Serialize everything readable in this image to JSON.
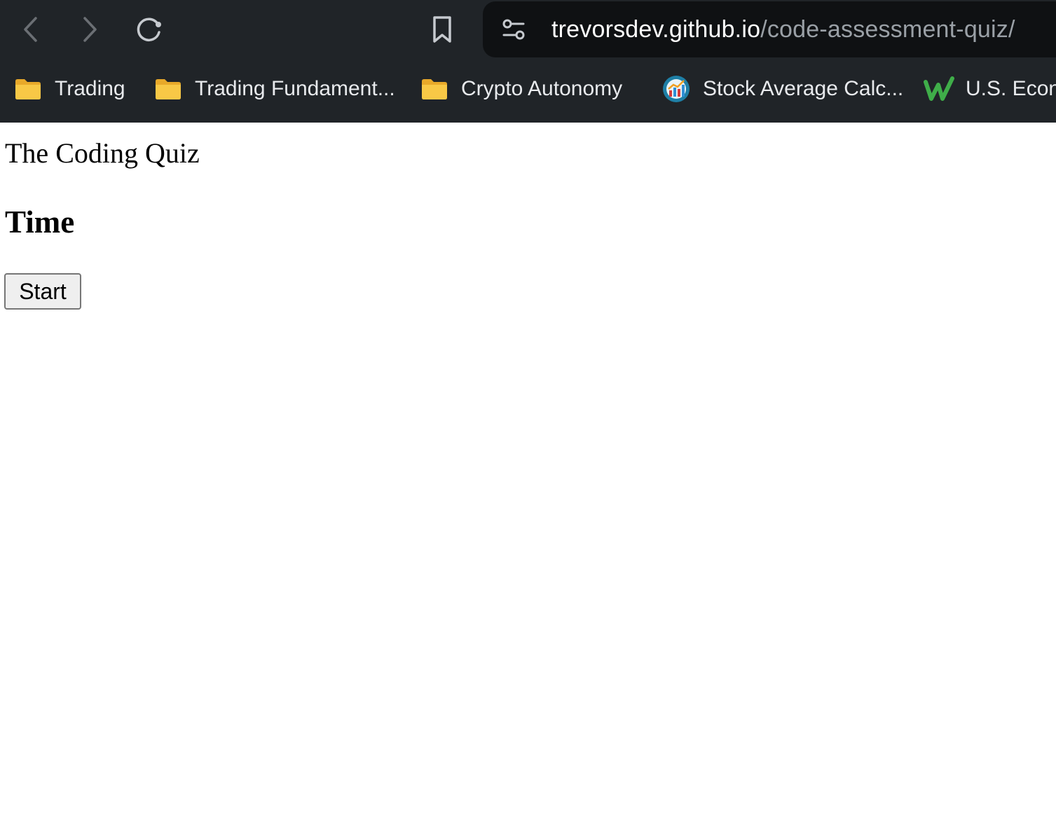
{
  "browser": {
    "url_host": "trevorsdev.github.io",
    "url_path": "/code-assessment-quiz/",
    "bookmarks": [
      {
        "label": "Trading",
        "icon": "folder-icon"
      },
      {
        "label": "Trading Fundament...",
        "icon": "folder-icon"
      },
      {
        "label": "Crypto Autonomy",
        "icon": "folder-icon"
      },
      {
        "label": "Stock Average Calc...",
        "icon": "chart-favicon-icon"
      },
      {
        "label": "U.S. Econo",
        "icon": "w-favicon-icon"
      }
    ],
    "colors": {
      "chrome_background": "#202428",
      "omnibox_background": "#0f1113",
      "folder_yellow": "#f8c846",
      "w_favicon_green": "#3fae49"
    }
  },
  "page": {
    "title": "The Coding Quiz",
    "timer_heading": "Time",
    "start_button": "Start"
  }
}
